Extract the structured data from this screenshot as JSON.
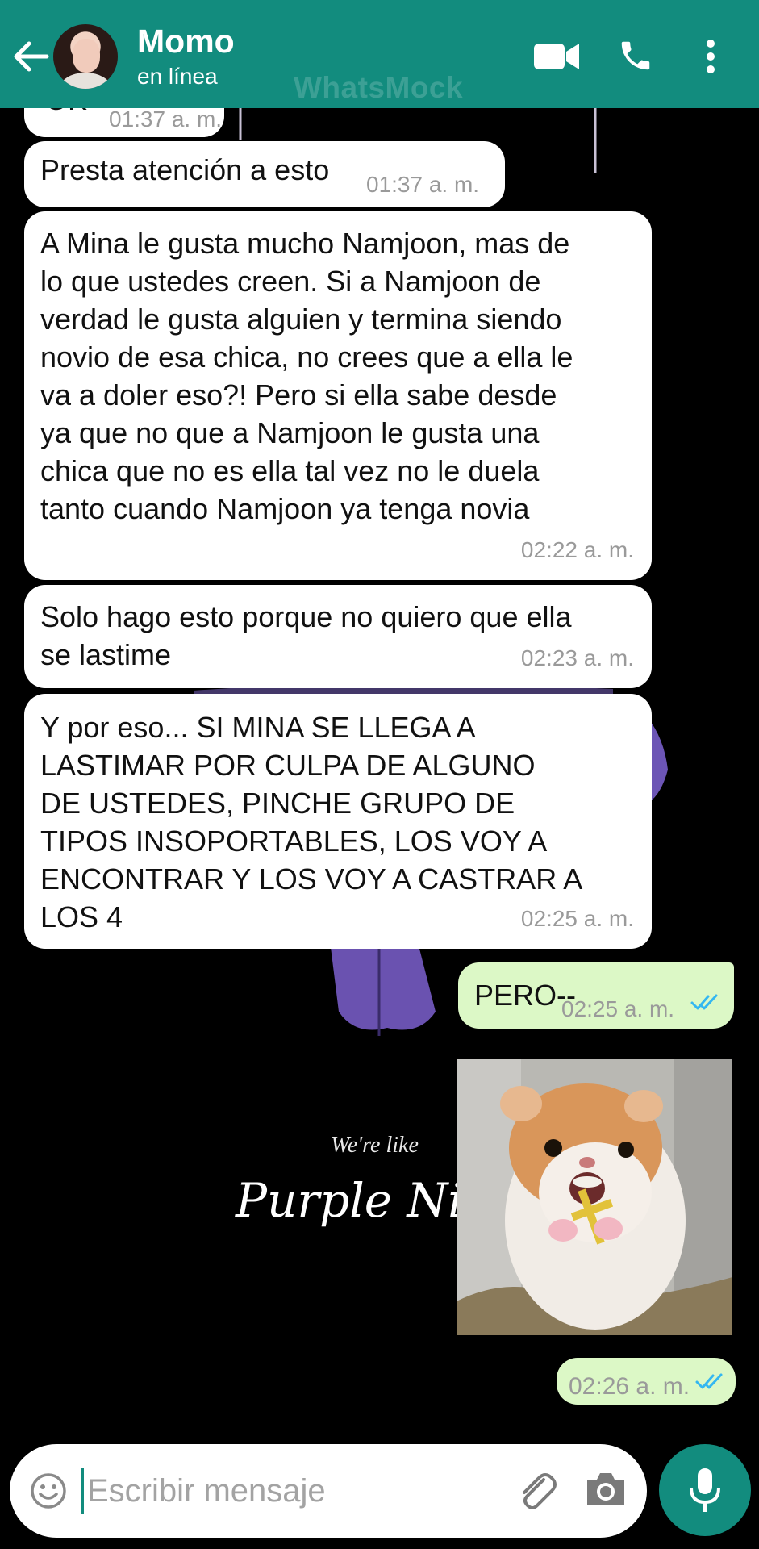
{
  "header": {
    "contact_name": "Momo",
    "status": "en línea",
    "watermark": "WhatsMock",
    "color": "#128c7e"
  },
  "messages": [
    {
      "direction": "in",
      "text": "OK",
      "time": "01:37 a. m.",
      "partially_visible": true
    },
    {
      "direction": "in",
      "text": "Presta atención a esto",
      "time": "01:37 a. m."
    },
    {
      "direction": "in",
      "text": "A Mina le gusta mucho Namjoon, mas de\nlo que ustedes creen. Si a Namjoon de\nverdad le gusta alguien y termina siendo\nnovio de esa chica, no crees que a ella le\nva a doler eso?! Pero si ella sabe desde\nya que no que a Namjoon le gusta una\nchica que no es ella tal vez no le duela\ntanto cuando Namjoon ya tenga novia",
      "time": "02:22 a. m."
    },
    {
      "direction": "in",
      "text": "Solo hago esto porque no quiero que ella\nse lastime",
      "time": "02:23 a. m."
    },
    {
      "direction": "in",
      "text": "Y por eso... SI MINA SE LLEGA A\nLASTIMAR POR CULPA DE ALGUNO\nDE USTEDES, PINCHE GRUPO DE\nTIPOS INSOPORTABLES, LOS VOY A\nENCONTRAR Y LOS VOY A CASTRAR A\nLOS 4",
      "time": "02:25 a. m."
    },
    {
      "direction": "out",
      "text": "PERO--",
      "time": "02:25 a. m.",
      "status": "read"
    },
    {
      "direction": "out",
      "type": "sticker",
      "sticker": "scared hamster holding a cross",
      "time": "02:26 a. m.",
      "status": "read"
    }
  ],
  "background": {
    "art_text_1": "We're like",
    "art_text_2": "Purple Ni"
  },
  "input": {
    "placeholder": "Escribir mensaje",
    "value": ""
  },
  "icons": {
    "back": "arrow-left-icon",
    "video": "video-call-icon",
    "call": "phone-icon",
    "menu": "more-vert-icon",
    "emoji": "emoji-icon",
    "attach": "paperclip-icon",
    "camera": "camera-icon",
    "mic": "mic-icon",
    "read": "double-check-icon"
  },
  "colors": {
    "incoming": "#ffffff",
    "outgoing": "#dcf8c6",
    "read_ticks": "#34b7f1"
  }
}
